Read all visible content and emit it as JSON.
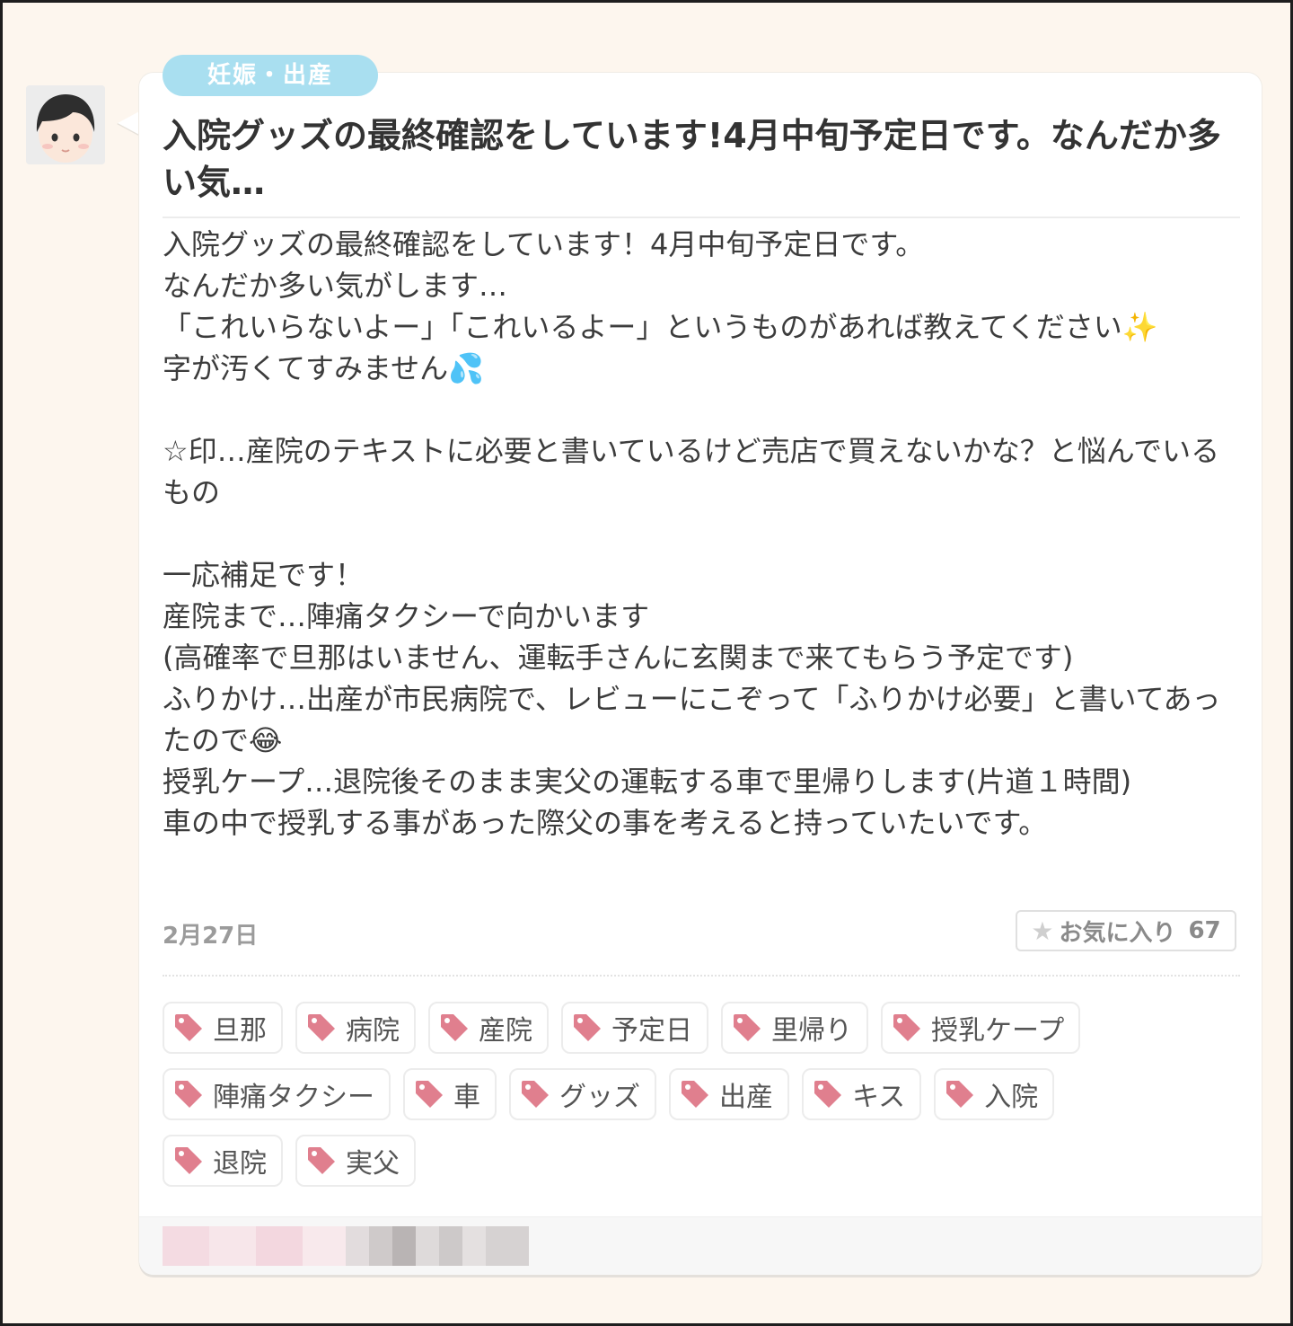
{
  "post": {
    "category": "妊娠・出産",
    "title": "入院グッズの最終確認をしています!4月中旬予定日です。なんだか多い気…",
    "body": "入院グッズの最終確認をしています！4月中旬予定日です。\nなんだか多い気がします…\n「これいらないよー」「これいるよー」というものがあれば教えてください✨\n字が汚くてすみません💦\n\n☆印…産院のテキストに必要と書いているけど売店で買えないかな？と悩んでいるもの\n\n一応補足です！\n産院まで…陣痛タクシーで向かいます\n(高確率で旦那はいません、運転手さんに玄関まで来てもらう予定です)\nふりかけ…出産が市民病院で、レビューにこぞって「ふりかけ必要」と書いてあったので😂\n授乳ケープ…退院後そのまま実父の運転する車で里帰りします(片道１時間)\n車の中で授乳する事があった際父の事を考えると持っていたいです。",
    "date": "2月27日",
    "favorite": {
      "label": "お気に入り",
      "count": "67",
      "icon": "star-icon"
    }
  },
  "tags": [
    "旦那",
    "病院",
    "産院",
    "予定日",
    "里帰り",
    "授乳ケープ",
    "陣痛タクシー",
    "車",
    "グッズ",
    "出産",
    "キス",
    "入院",
    "退院",
    "実父"
  ],
  "colors": {
    "background": "#fdf6ee",
    "category_badge": "#a9dff0",
    "tag_icon": "#e07f8e",
    "text": "#3c3c3c",
    "muted": "#9b9b9b"
  }
}
